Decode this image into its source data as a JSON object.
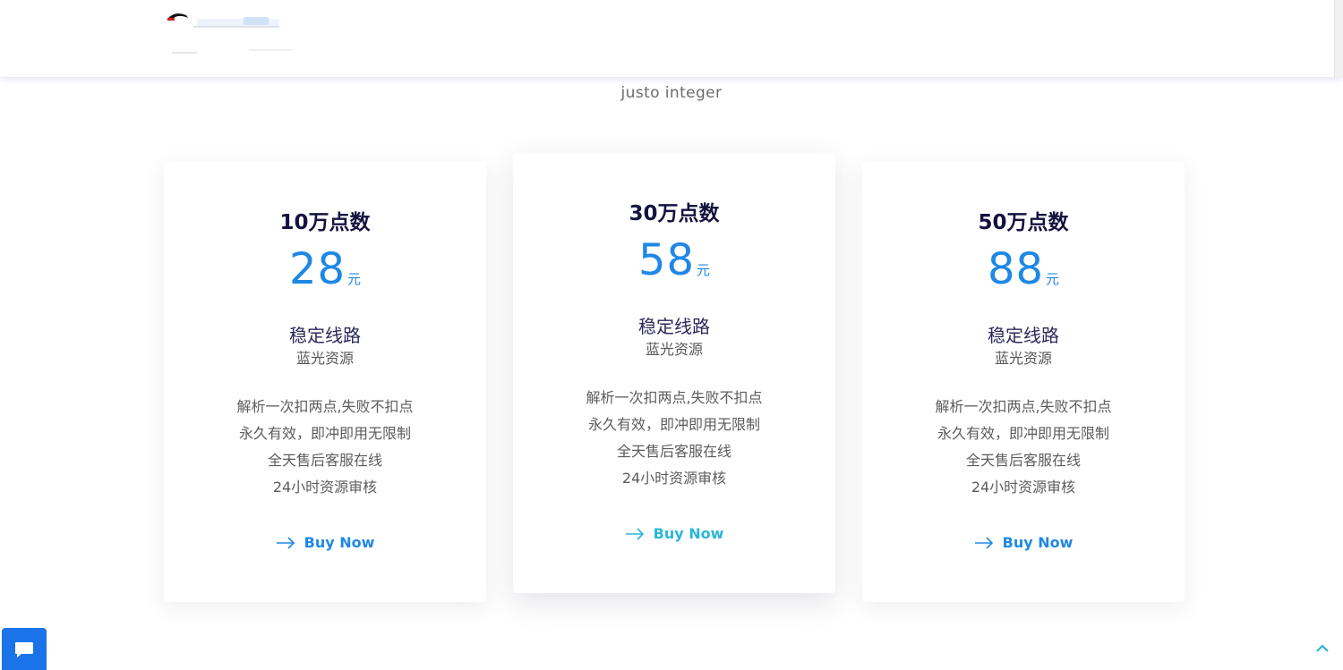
{
  "header": {
    "logo_icon": "site-logo"
  },
  "section": {
    "subtitle": "justo integer"
  },
  "plans": [
    {
      "name": "10万点数",
      "price": "28",
      "unit": "元",
      "feature_title": "稳定线路",
      "feature_sub": "蓝光资源",
      "features": [
        "解析一次扣两点,失败不扣点",
        "永久有效，即冲即用无限制",
        "全天售后客服在线",
        "24小时资源审核"
      ],
      "buy_label": "Buy Now"
    },
    {
      "name": "30万点数",
      "price": "58",
      "unit": "元",
      "feature_title": "稳定线路",
      "feature_sub": "蓝光资源",
      "features": [
        "解析一次扣两点,失败不扣点",
        "永久有效，即冲即用无限制",
        "全天售后客服在线",
        "24小时资源审核"
      ],
      "buy_label": "Buy Now"
    },
    {
      "name": "50万点数",
      "price": "88",
      "unit": "元",
      "feature_title": "稳定线路",
      "feature_sub": "蓝光资源",
      "features": [
        "解析一次扣两点,失败不扣点",
        "永久有效，即冲即用无限制",
        "全天售后客服在线",
        "24小时资源审核"
      ],
      "buy_label": "Buy Now"
    }
  ],
  "colors": {
    "accent": "#1e88e5",
    "featured_accent": "#29b6d8",
    "title": "#141340",
    "chat_button": "#1a73e8"
  },
  "icons": {
    "chat": "chat-bubble-icon",
    "back_to_top": "chevron-up-icon",
    "buy": "arrow-right-icon"
  }
}
